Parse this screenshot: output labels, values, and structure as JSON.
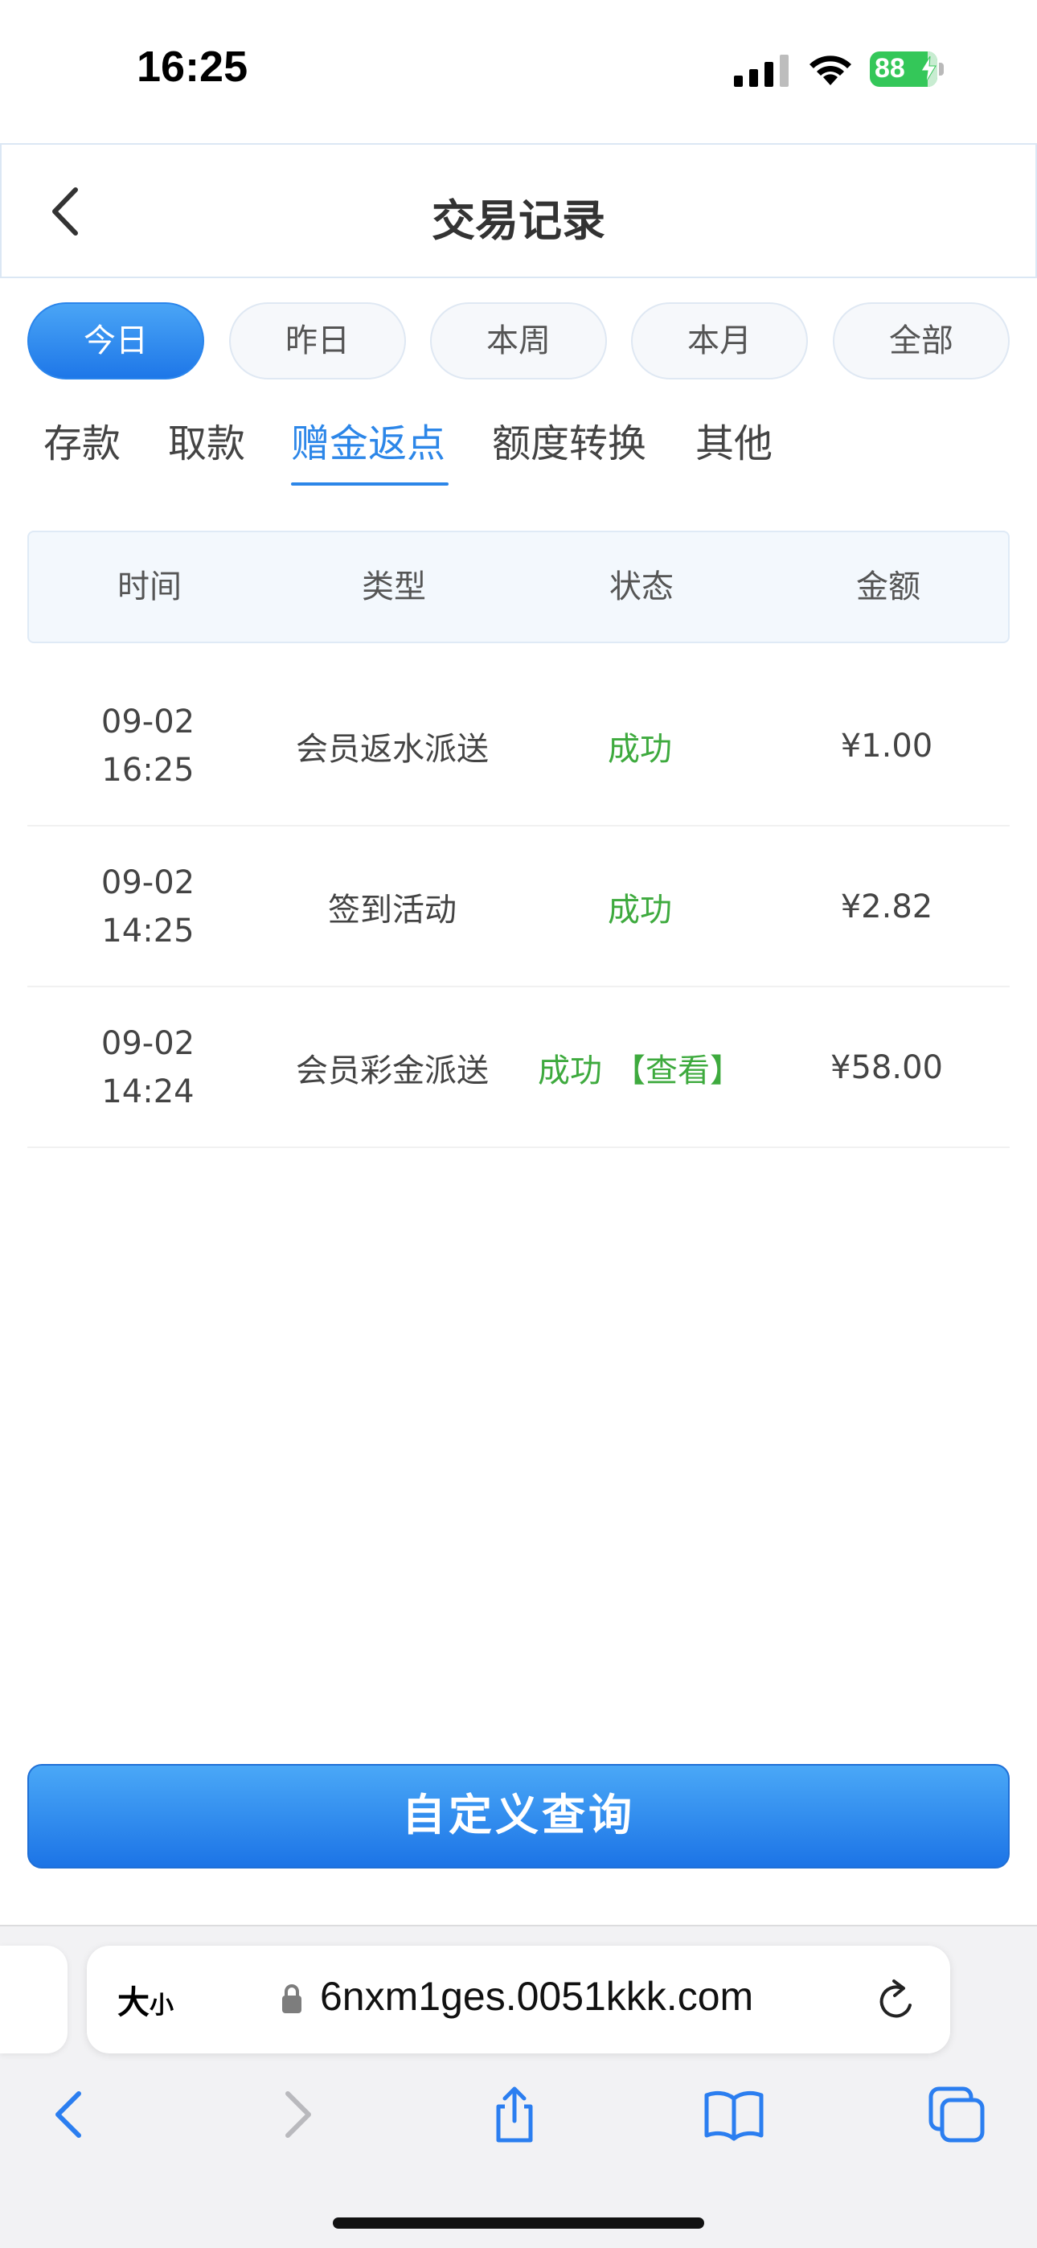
{
  "status_bar": {
    "time": "16:25",
    "battery": "88"
  },
  "header": {
    "title": "交易记录"
  },
  "periods": [
    "今日",
    "昨日",
    "本周",
    "本月",
    "全部"
  ],
  "tabs": [
    "存款",
    "取款",
    "赠金返点",
    "额度转换",
    "其他"
  ],
  "table": {
    "columns": [
      "时间",
      "类型",
      "状态",
      "金额"
    ],
    "rows": [
      {
        "date": "09-02",
        "time": "16:25",
        "type": "会员返水派送",
        "status": "成功",
        "link": "",
        "amount": "¥1.00"
      },
      {
        "date": "09-02",
        "time": "14:25",
        "type": "签到活动",
        "status": "成功",
        "link": "",
        "amount": "¥2.82"
      },
      {
        "date": "09-02",
        "time": "14:24",
        "type": "会员彩金派送",
        "status": "成功",
        "link": "【查看】",
        "amount": "¥58.00"
      }
    ]
  },
  "query_button": "自定义查询",
  "browser": {
    "text_size_big": "大",
    "text_size_small": "小",
    "url": "6nxm1ges.0051kkk.com"
  },
  "icons": {
    "back": "chevron-left-icon",
    "lock": "lock-icon",
    "reload": "reload-icon",
    "nav_back": "chevron-left-icon",
    "nav_forward": "chevron-right-icon",
    "share": "share-icon",
    "bookmarks": "book-icon",
    "tabs": "tabs-icon"
  },
  "colors": {
    "accent": "#2c86e8",
    "success": "#3eaa3e",
    "battery": "#34c759"
  }
}
